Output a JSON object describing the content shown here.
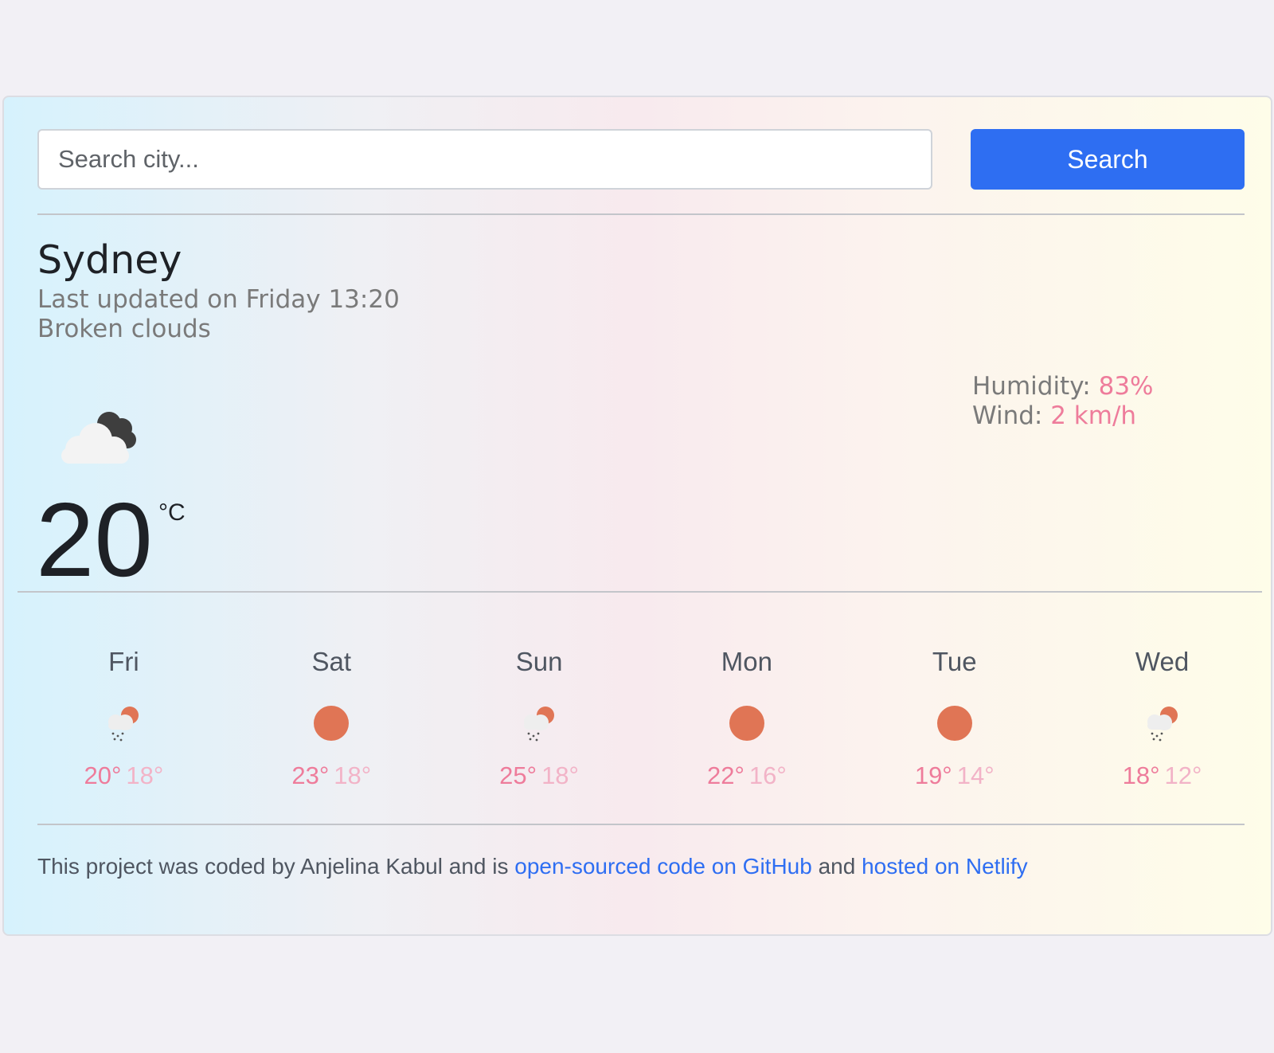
{
  "search": {
    "placeholder": "Search city...",
    "value": "",
    "button_label": "Search"
  },
  "current": {
    "city": "Sydney",
    "last_updated": "Last updated on Friday 13:20",
    "description": "Broken clouds",
    "icon": "broken-clouds-icon",
    "temperature": "20",
    "unit": "°C",
    "humidity_label": "Humidity:",
    "humidity_value": "83%",
    "wind_label": "Wind:",
    "wind_value": "2 km/h"
  },
  "forecast": [
    {
      "day": "Fri",
      "icon": "rain-sun-icon",
      "max": "20°",
      "min": "18°"
    },
    {
      "day": "Sat",
      "icon": "sun-icon",
      "max": "23°",
      "min": "18°"
    },
    {
      "day": "Sun",
      "icon": "rain-sun-icon",
      "max": "25°",
      "min": "18°"
    },
    {
      "day": "Mon",
      "icon": "sun-icon",
      "max": "22°",
      "min": "16°"
    },
    {
      "day": "Tue",
      "icon": "sun-icon",
      "max": "19°",
      "min": "14°"
    },
    {
      "day": "Wed",
      "icon": "rain-sun-icon",
      "max": "18°",
      "min": "12°"
    }
  ],
  "footer": {
    "text_before": "This project was coded by Anjelina Kabul and is",
    "github_link": "open-sourced code on GitHub",
    "text_middle": "and",
    "netlify_link": "hosted on Netlify"
  },
  "colors": {
    "accent": "#2e6ef2",
    "temp_max": "#ee7c9b",
    "temp_min": "#f2b3c7",
    "sun": "#e07555"
  }
}
